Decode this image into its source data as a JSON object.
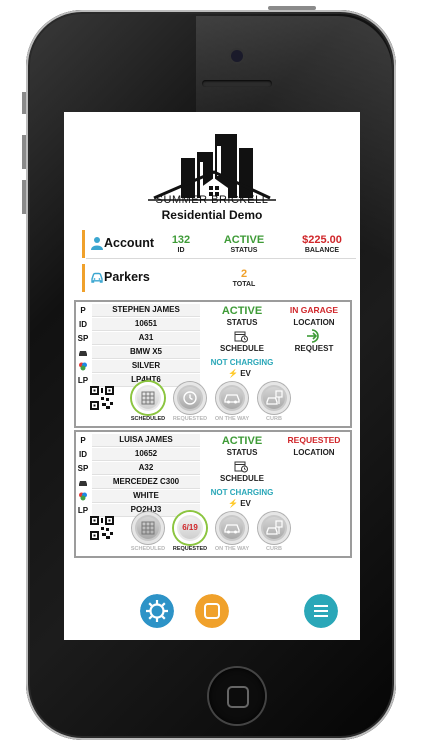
{
  "brand": {
    "name": "SUMMER BRICKELL",
    "subtitle": "Residential Demo"
  },
  "account": {
    "label": "Account",
    "id_value": "132",
    "id_label": "ID",
    "status_value": "ACTIVE",
    "status_label": "STATUS",
    "balance_value": "$225.00",
    "balance_label": "BALANCE"
  },
  "parkers": {
    "label": "Parkers",
    "total_value": "2",
    "total_label": "TOTAL"
  },
  "cards": [
    {
      "P": "STEPHEN JAMES",
      "ID": "10651",
      "SP": "A31",
      "car": "BMW X5",
      "color": "SILVER",
      "LP": "LP4HT6",
      "status_value": "ACTIVE",
      "status_label": "STATUS",
      "location_value": "IN GARAGE",
      "location_label": "LOCATION",
      "schedule_label": "SCHEDULE",
      "request_label": "REQUEST",
      "charge_value": "NOT CHARGING",
      "ev_label": "EV",
      "steps": [
        "SCHEDULED",
        "REQUESTED",
        "ON THE WAY",
        "CURB"
      ],
      "active_step": 0
    },
    {
      "P": "LUISA JAMES",
      "ID": "10652",
      "SP": "A32",
      "car": "MERCEDEZ C300",
      "color": "WHITE",
      "LP": "PO2HJ3",
      "status_value": "ACTIVE",
      "status_label": "STATUS",
      "location_value": "REQUESTED",
      "location_label": "LOCATION",
      "schedule_label": "SCHEDULE",
      "charge_value": "NOT CHARGING",
      "ev_label": "EV",
      "request_date": "6/19",
      "steps": [
        "SCHEDULED",
        "REQUESTED",
        "ON THE WAY",
        "CURB"
      ],
      "active_step": 1
    }
  ],
  "labels": {
    "P": "P",
    "ID": "ID",
    "SP": "SP",
    "LP": "LP"
  },
  "colors": {
    "green": "#3e9b37",
    "red": "#d0262a",
    "teal": "#2aa7b8",
    "orange": "#f0a12b",
    "blue": "#2d93c7"
  }
}
